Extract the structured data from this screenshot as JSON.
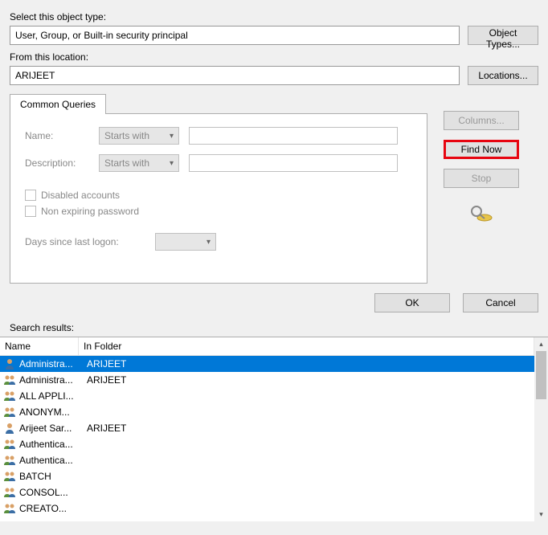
{
  "labels": {
    "objectType": "Select this object type:",
    "location": "From this location:",
    "searchResults": "Search results:"
  },
  "fields": {
    "objectType": "User, Group, or Built-in security principal",
    "location": "ARIJEET"
  },
  "buttons": {
    "objectTypes": "Object Types...",
    "locations": "Locations...",
    "columns": "Columns...",
    "findNow": "Find Now",
    "stop": "Stop",
    "ok": "OK",
    "cancel": "Cancel"
  },
  "tab": {
    "label": "Common Queries"
  },
  "query": {
    "nameLabel": "Name:",
    "descLabel": "Description:",
    "nameMode": "Starts with",
    "descMode": "Starts with",
    "disabledAccounts": "Disabled accounts",
    "nonExpiring": "Non expiring password",
    "daysSince": "Days since last logon:"
  },
  "columns": {
    "name": "Name",
    "folder": "In Folder"
  },
  "results": [
    {
      "name": "Administra...",
      "folder": "ARIJEET",
      "icon": "user",
      "selected": true
    },
    {
      "name": "Administra...",
      "folder": "ARIJEET",
      "icon": "group",
      "selected": false
    },
    {
      "name": "ALL APPLI...",
      "folder": "",
      "icon": "group",
      "selected": false
    },
    {
      "name": "ANONYM...",
      "folder": "",
      "icon": "group",
      "selected": false
    },
    {
      "name": "Arijeet Sar...",
      "folder": "ARIJEET",
      "icon": "user",
      "selected": false
    },
    {
      "name": "Authentica...",
      "folder": "",
      "icon": "group",
      "selected": false
    },
    {
      "name": "Authentica...",
      "folder": "",
      "icon": "group",
      "selected": false
    },
    {
      "name": "BATCH",
      "folder": "",
      "icon": "group",
      "selected": false
    },
    {
      "name": "CONSOL...",
      "folder": "",
      "icon": "group",
      "selected": false
    },
    {
      "name": "CREATO...",
      "folder": "",
      "icon": "group",
      "selected": false
    }
  ]
}
